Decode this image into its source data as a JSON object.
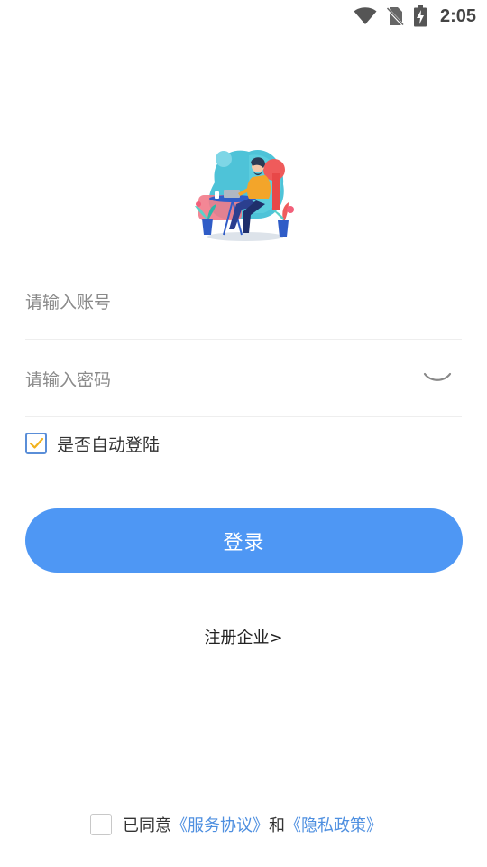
{
  "status_bar": {
    "time": "2:05",
    "icons": [
      "wifi-icon",
      "no-sim-icon",
      "battery-charging-icon"
    ]
  },
  "illustration": {
    "icon": "person-working-at-laptop-illustration"
  },
  "form": {
    "account": {
      "placeholder": "请输入账号",
      "value": ""
    },
    "password": {
      "placeholder": "请输入密码",
      "value": "",
      "toggle_icon": "eye-closed-icon"
    },
    "auto_login": {
      "label": "是否自动登陆",
      "checked": true
    },
    "login_button": {
      "label": "登录",
      "color": "#4e97f4"
    }
  },
  "register": {
    "label": "注册企业>"
  },
  "agreement": {
    "checked": false,
    "prefix": "已同意",
    "service_link": "《服务协议》",
    "and": "和",
    "privacy_link": "《隐私政策》",
    "link_color": "#4e8fe0"
  }
}
